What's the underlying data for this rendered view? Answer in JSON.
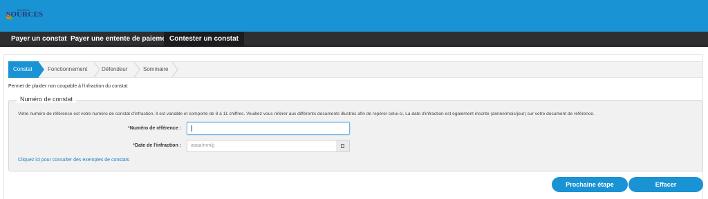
{
  "header": {
    "logo_small_text": "MILIEUX",
    "logo_text": "SOURCES"
  },
  "nav": {
    "items": [
      {
        "label": "Payer un constat"
      },
      {
        "label": "Payer une entente de paiement"
      },
      {
        "label": "Contester un constat"
      }
    ]
  },
  "stepper": {
    "steps": [
      {
        "label": "Constat",
        "active": true
      },
      {
        "label": "Fonctionnement",
        "active": false
      },
      {
        "label": "Défendeur",
        "active": false
      },
      {
        "label": "Sommaire",
        "active": false
      }
    ]
  },
  "page": {
    "description": "Permet de plaider non coupable à l'infraction du constat"
  },
  "form": {
    "legend": "Numéro de constat",
    "help": "Votre numéro de référence est votre numéro de constat d'infraction. Il est variable et comporte de 8 à 11 chiffres. Veuillez vous référer aux différents documents illustrés afin de repérer celui-ci. La date d'infraction est également inscrite (année/mois/jour) sur votre document de référence.",
    "required_marker": "*",
    "reference": {
      "label": "Numéro de référence :",
      "value": ""
    },
    "date": {
      "label": "Date de l'infraction :",
      "placeholder": "aaaa/mm/jj"
    },
    "examples_link": "Cliquez ici pour consulter des exemples de constats"
  },
  "actions": {
    "next_label": "Prochaine étape",
    "clear_label": "Effacer"
  },
  "colors": {
    "primary": "#1a93d4",
    "navbar": "#2e2e30"
  }
}
